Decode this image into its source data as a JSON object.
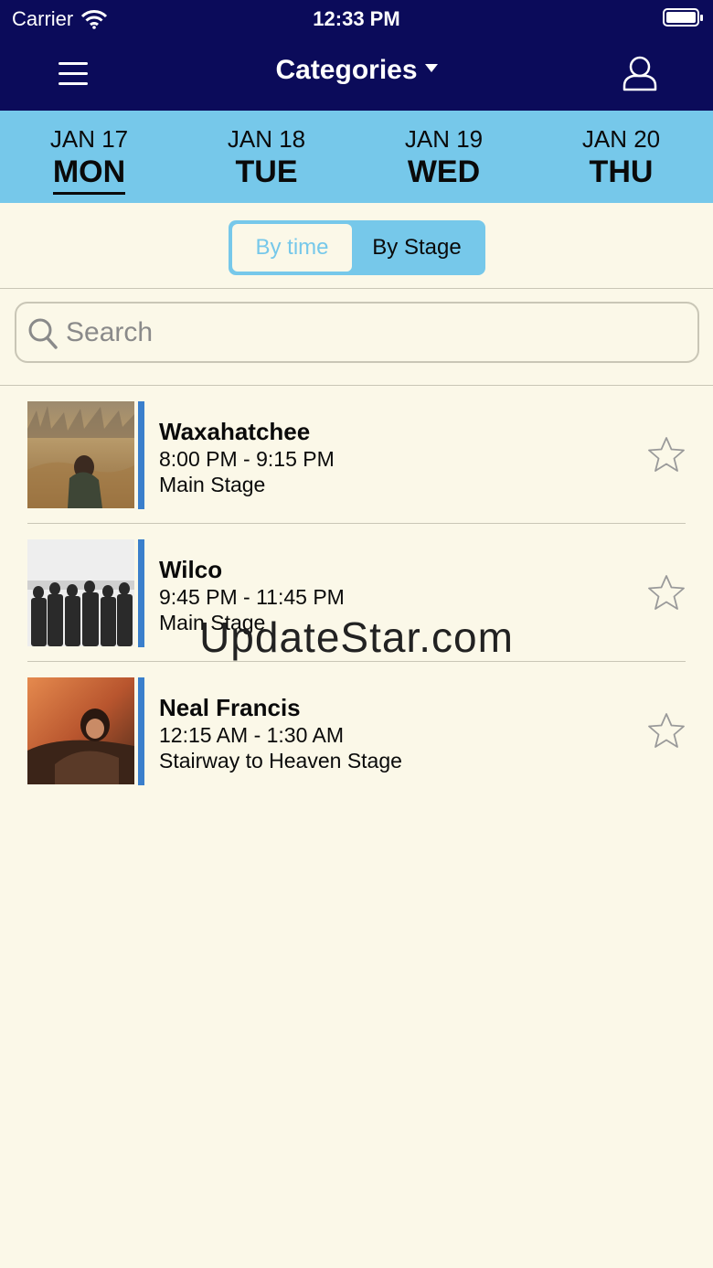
{
  "status_bar": {
    "carrier": "Carrier",
    "time": "12:33 PM"
  },
  "nav": {
    "title": "Categories",
    "menu_icon": "hamburger-menu-icon",
    "user_icon": "user-profile-icon",
    "background_color": "#0b0b5a"
  },
  "dates": [
    {
      "date": "JAN 17",
      "weekday": "MON",
      "active": true
    },
    {
      "date": "JAN 18",
      "weekday": "TUE",
      "active": false
    },
    {
      "date": "JAN 19",
      "weekday": "WED",
      "active": false
    },
    {
      "date": "JAN 20",
      "weekday": "THU",
      "active": false
    }
  ],
  "toggle": {
    "options": [
      "By time",
      "By Stage"
    ],
    "selected": "By time",
    "accent_color": "#76c8ea"
  },
  "search": {
    "placeholder": "Search",
    "value": ""
  },
  "events": [
    {
      "artist": "Waxahatchee",
      "time": "8:00 PM - 9:15 PM",
      "stage": "Main Stage",
      "favorite": false
    },
    {
      "artist": "Wilco",
      "time": "9:45 PM - 11:45 PM",
      "stage": "Main Stage",
      "favorite": false
    },
    {
      "artist": "Neal Francis",
      "time": "12:15 AM - 1:30 AM",
      "stage": "Stairway to Heaven Stage",
      "favorite": false
    }
  ],
  "watermark": "UpdateStar.com",
  "colors": {
    "page_background": "#fbf8e8",
    "date_bar": "#76c8ea",
    "event_accent": "#3a7fcc"
  }
}
